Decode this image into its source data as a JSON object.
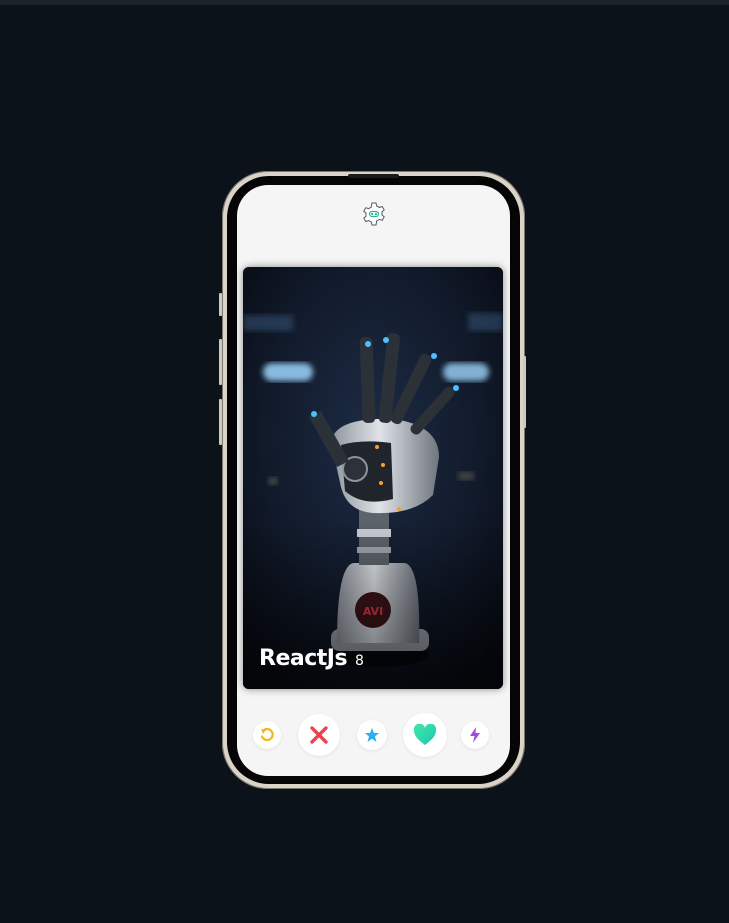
{
  "profile": {
    "name": "ReactJs",
    "age": "8"
  },
  "icons": {
    "settings": "gear-icon",
    "rewind": "undo-icon",
    "nope": "close-icon",
    "super_like": "star-icon",
    "like": "heart-icon",
    "boost": "lightning-icon"
  },
  "colors": {
    "background": "#0b1219",
    "screen": "#f5f5f5",
    "rewind": "#f5b519",
    "nope": "#f0424e",
    "super_like": "#2cb0f0",
    "like": "#28d6a6",
    "boost": "#a14be0",
    "settings_accent": "#29b98f"
  }
}
